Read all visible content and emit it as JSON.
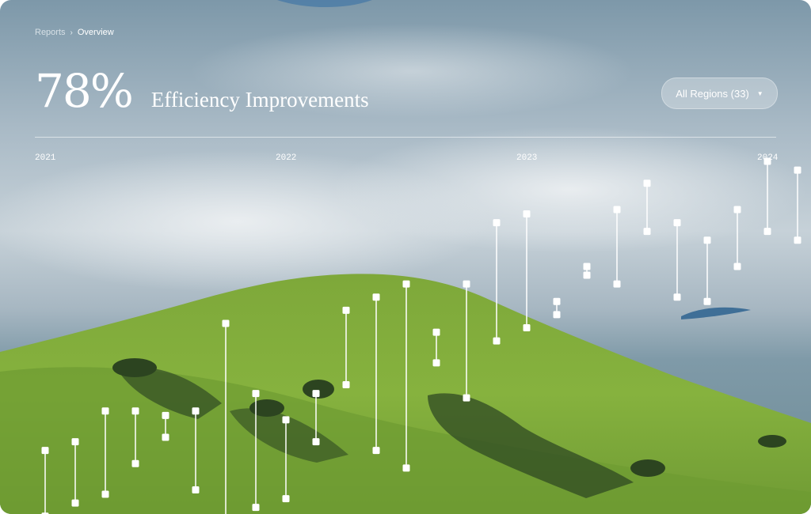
{
  "breadcrumb": {
    "parent": "Reports",
    "separator": "›",
    "current": "Overview"
  },
  "headline": {
    "value": "78%",
    "title": "Efficiency Improvements"
  },
  "region_filter": {
    "label": "All Regions (33)",
    "caret": "▼"
  },
  "years": [
    "2021",
    "2022",
    "2023",
    "2024"
  ],
  "colors": {
    "text": "#ffffff",
    "rule": "#ffffff"
  },
  "chart_data": {
    "type": "range",
    "x": [
      "2021-Q1",
      "2021-Q2",
      "2021-Q3",
      "2021-Q4",
      "2021-Q5",
      "2021-Q6",
      "2021-Q7",
      "2021-Q8",
      "2022-Q1",
      "2022-Q2",
      "2022-Q3",
      "2022-Q4",
      "2022-Q5",
      "2022-Q6",
      "2022-Q7",
      "2022-Q8",
      "2023-Q1",
      "2023-Q2",
      "2023-Q3",
      "2023-Q4",
      "2023-Q5",
      "2023-Q6",
      "2023-Q7",
      "2023-Q8",
      "2024-Q1",
      "2024-Q2"
    ],
    "series": [
      {
        "low": [
          0.06,
          0.09,
          0.11,
          0.18,
          0.24,
          0.12,
          0.02,
          0.08,
          0.1,
          0.23,
          0.36,
          0.21,
          0.17,
          0.41,
          0.33,
          0.46,
          0.49,
          0.52,
          0.61,
          0.59,
          0.71,
          0.56,
          0.55,
          0.63,
          0.71,
          0.69
        ],
        "high": [
          0.21,
          0.23,
          0.3,
          0.3,
          0.29,
          0.3,
          0.5,
          0.34,
          0.28,
          0.34,
          0.53,
          0.56,
          0.59,
          0.48,
          0.59,
          0.73,
          0.75,
          0.55,
          0.63,
          0.76,
          0.82,
          0.73,
          0.69,
          0.76,
          0.87,
          0.85
        ]
      }
    ],
    "ylim": [
      0,
      1
    ],
    "grid": false,
    "legend": "none"
  }
}
